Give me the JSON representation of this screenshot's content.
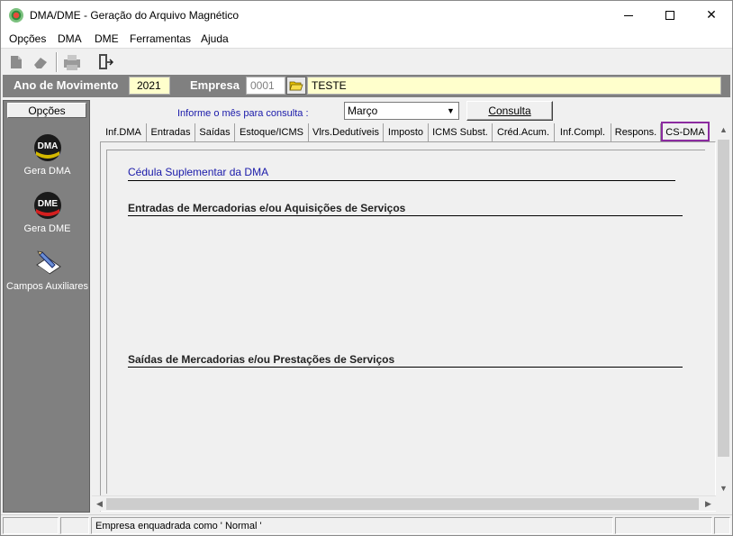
{
  "window": {
    "title": "DMA/DME - Geração do Arquivo Magnético"
  },
  "menu": [
    "Opções",
    "DMA",
    "DME",
    "Ferramentas",
    "Ajuda"
  ],
  "anobar": {
    "ano_label": "Ano de Movimento",
    "ano_value": "2021",
    "empresa_label": "Empresa",
    "empresa_code": "0001",
    "empresa_name": "TESTE"
  },
  "leftpanel": {
    "header": "Opções",
    "tools": [
      {
        "label": "Gera DMA",
        "icon": "dma-icon",
        "badge": "DMA"
      },
      {
        "label": "Gera DME",
        "icon": "dme-icon",
        "badge": "DME"
      },
      {
        "label": "Campos Auxiliares",
        "icon": "notepad-pencil-icon"
      }
    ]
  },
  "query": {
    "label": "Informe o mês para consulta :",
    "month": "Março",
    "button": "Consulta"
  },
  "tabs": [
    "Inf.DMA",
    "Entradas",
    "Saídas",
    "Estoque/ICMS",
    "Vlrs.Dedutíveis",
    "Imposto",
    "ICMS Subst.",
    "Créd.Acum.",
    "Inf.Compl.",
    "Respons.",
    "CS-DMA"
  ],
  "active_tab": "CS-DMA",
  "content": {
    "title": "Cédula Suplementar da DMA",
    "section1": "Entradas de Mercadorias e/ou Aquisições de Serviços",
    "section2": "Saídas de Mercadorias e/ou Prestações de Serviços"
  },
  "status": {
    "message": "Empresa enquadrada como ' Normal '"
  }
}
